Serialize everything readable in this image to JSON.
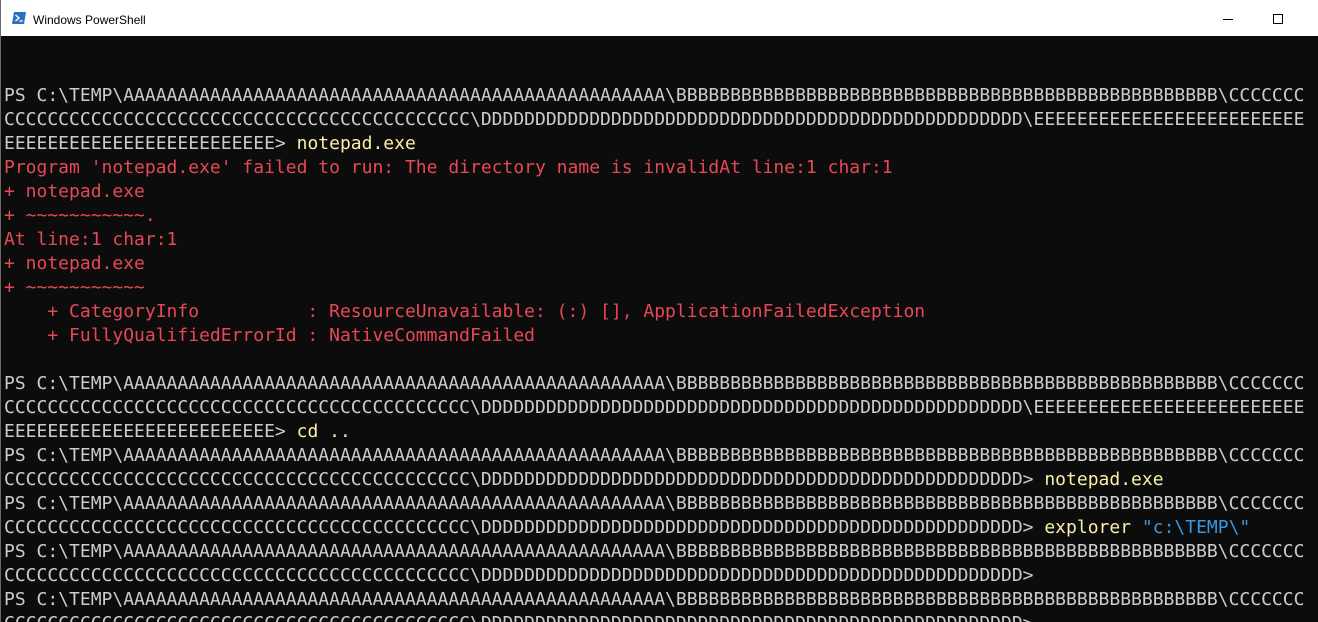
{
  "window": {
    "title": "Windows PowerShell"
  },
  "icons": {
    "app": "powershell-icon",
    "minimize": "minimize-icon",
    "maximize": "maximize-icon"
  },
  "colors": {
    "background": "#0c0c0c",
    "text": "#cccccc",
    "error": "#e74856",
    "command": "#f9f1a5",
    "string": "#3a96dd"
  },
  "console": {
    "lines": [
      [
        {
          "text": "PS C:\\TEMP\\AAAAAAAAAAAAAAAAAAAAAAAAAAAAAAAAAAAAAAAAAAAAAAAAAA\\BBBBBBBBBBBBBBBBBBBBBBBBBBBBBBBBBBBBBBBBBBBBBBBBBB\\CCCCCCC",
          "kind": "text"
        }
      ],
      [
        {
          "text": "CCCCCCCCCCCCCCCCCCCCCCCCCCCCCCCCCCCCCCCCCCC\\DDDDDDDDDDDDDDDDDDDDDDDDDDDDDDDDDDDDDDDDDDDDDDDDDD\\EEEEEEEEEEEEEEEEEEEEEEEEE",
          "kind": "text"
        }
      ],
      [
        {
          "text": "EEEEEEEEEEEEEEEEEEEEEEEEE> ",
          "kind": "text"
        },
        {
          "text": "notepad.exe",
          "kind": "cmd"
        }
      ],
      [
        {
          "text": "Program 'notepad.exe' failed to run: The directory name is invalidAt line:1 char:1",
          "kind": "err"
        }
      ],
      [
        {
          "text": "+ notepad.exe",
          "kind": "err"
        }
      ],
      [
        {
          "text": "+ ~~~~~~~~~~~.",
          "kind": "err"
        }
      ],
      [
        {
          "text": "At line:1 char:1",
          "kind": "err"
        }
      ],
      [
        {
          "text": "+ notepad.exe",
          "kind": "err"
        }
      ],
      [
        {
          "text": "+ ~~~~~~~~~~~",
          "kind": "err"
        }
      ],
      [
        {
          "text": "    + CategoryInfo          : ResourceUnavailable: (:) [], ApplicationFailedException",
          "kind": "err"
        }
      ],
      [
        {
          "text": "    + FullyQualifiedErrorId : NativeCommandFailed",
          "kind": "err"
        }
      ],
      [
        {
          "text": "",
          "kind": "text"
        }
      ],
      [
        {
          "text": "PS C:\\TEMP\\AAAAAAAAAAAAAAAAAAAAAAAAAAAAAAAAAAAAAAAAAAAAAAAAAA\\BBBBBBBBBBBBBBBBBBBBBBBBBBBBBBBBBBBBBBBBBBBBBBBBBB\\CCCCCCC",
          "kind": "text"
        }
      ],
      [
        {
          "text": "CCCCCCCCCCCCCCCCCCCCCCCCCCCCCCCCCCCCCCCCCCC\\DDDDDDDDDDDDDDDDDDDDDDDDDDDDDDDDDDDDDDDDDDDDDDDDDD\\EEEEEEEEEEEEEEEEEEEEEEEEE",
          "kind": "text"
        }
      ],
      [
        {
          "text": "EEEEEEEEEEEEEEEEEEEEEEEEE> ",
          "kind": "text"
        },
        {
          "text": "cd ..",
          "kind": "cmd"
        }
      ],
      [
        {
          "text": "PS C:\\TEMP\\AAAAAAAAAAAAAAAAAAAAAAAAAAAAAAAAAAAAAAAAAAAAAAAAAA\\BBBBBBBBBBBBBBBBBBBBBBBBBBBBBBBBBBBBBBBBBBBBBBBBBB\\CCCCCCC",
          "kind": "text"
        }
      ],
      [
        {
          "text": "CCCCCCCCCCCCCCCCCCCCCCCCCCCCCCCCCCCCCCCCCCC\\DDDDDDDDDDDDDDDDDDDDDDDDDDDDDDDDDDDDDDDDDDDDDDDDDD> ",
          "kind": "text"
        },
        {
          "text": "notepad.exe",
          "kind": "cmd"
        }
      ],
      [
        {
          "text": "PS C:\\TEMP\\AAAAAAAAAAAAAAAAAAAAAAAAAAAAAAAAAAAAAAAAAAAAAAAAAA\\BBBBBBBBBBBBBBBBBBBBBBBBBBBBBBBBBBBBBBBBBBBBBBBBBB\\CCCCCCC",
          "kind": "text"
        }
      ],
      [
        {
          "text": "CCCCCCCCCCCCCCCCCCCCCCCCCCCCCCCCCCCCCCCCCCC\\DDDDDDDDDDDDDDDDDDDDDDDDDDDDDDDDDDDDDDDDDDDDDDDDDD> ",
          "kind": "text"
        },
        {
          "text": "explorer ",
          "kind": "cmd"
        },
        {
          "text": "\"c:\\TEMP\\\"",
          "kind": "str"
        }
      ],
      [
        {
          "text": "PS C:\\TEMP\\AAAAAAAAAAAAAAAAAAAAAAAAAAAAAAAAAAAAAAAAAAAAAAAAAA\\BBBBBBBBBBBBBBBBBBBBBBBBBBBBBBBBBBBBBBBBBBBBBBBBBB\\CCCCCCC",
          "kind": "text"
        }
      ],
      [
        {
          "text": "CCCCCCCCCCCCCCCCCCCCCCCCCCCCCCCCCCCCCCCCCCC\\DDDDDDDDDDDDDDDDDDDDDDDDDDDDDDDDDDDDDDDDDDDDDDDDDD>",
          "kind": "text"
        }
      ],
      [
        {
          "text": "PS C:\\TEMP\\AAAAAAAAAAAAAAAAAAAAAAAAAAAAAAAAAAAAAAAAAAAAAAAAAA\\BBBBBBBBBBBBBBBBBBBBBBBBBBBBBBBBBBBBBBBBBBBBBBBBBB\\CCCCCCC",
          "kind": "text"
        }
      ],
      [
        {
          "text": "CCCCCCCCCCCCCCCCCCCCCCCCCCCCCCCCCCCCCCCCCCC\\DDDDDDDDDDDDDDDDDDDDDDDDDDDDDDDDDDDDDDDDDDDDDDDDDD>",
          "kind": "text"
        }
      ]
    ]
  }
}
